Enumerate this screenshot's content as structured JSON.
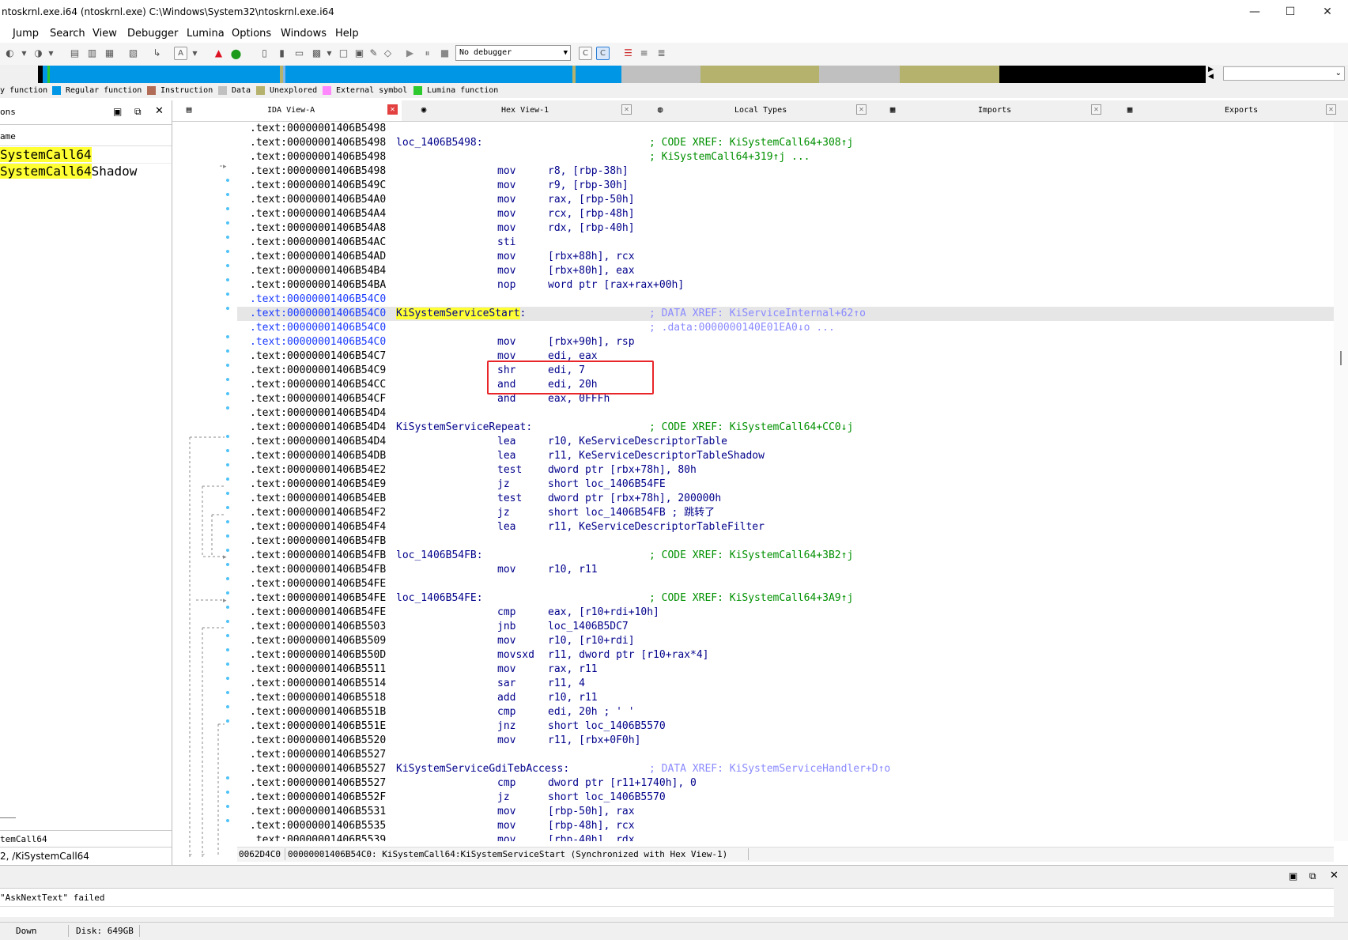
{
  "window": {
    "title": "ntoskrnl.exe.i64 (ntoskrnl.exe) C:\\Windows\\System32\\ntoskrnl.exe.i64",
    "minimize_glyph": "—",
    "maximize_glyph": "☐",
    "close_glyph": "✕"
  },
  "menu": [
    "Jump",
    "Search",
    "View",
    "Debugger",
    "Lumina",
    "Options",
    "Windows",
    "Help"
  ],
  "toolbar": {
    "debugger_select": "No debugger"
  },
  "legend": {
    "items": [
      {
        "label": "y function",
        "color": null
      },
      {
        "label": "Regular function",
        "color": "#0096e6"
      },
      {
        "label": "Instruction",
        "color": "#b06c56"
      },
      {
        "label": "Data",
        "color": "#c0c0c0"
      },
      {
        "label": "Unexplored",
        "color": "#b5b26d"
      },
      {
        "label": "External symbol",
        "color": "#ff88ff"
      },
      {
        "label": "Lumina function",
        "color": "#2ec92e"
      }
    ]
  },
  "left_panel": {
    "title": "ons",
    "column_header": "ame",
    "items": [
      {
        "highlight": "SystemCall64",
        "rest": ""
      },
      {
        "highlight": "SystemCall64",
        "rest": "Shadow"
      }
    ],
    "footer_line1": "temCall64",
    "footer_line2": "2, /KiSystemCall64"
  },
  "tabs": [
    {
      "label": "IDA View-A",
      "icon": "ida-view-icon",
      "active": true
    },
    {
      "label": "Hex View-1",
      "icon": "hex-view-icon",
      "active": false
    },
    {
      "label": "Local Types",
      "icon": "local-types-icon",
      "active": false
    },
    {
      "label": "Imports",
      "icon": "imports-icon",
      "active": false
    },
    {
      "label": "Exports",
      "icon": "exports-icon",
      "active": false
    }
  ],
  "code": {
    "lines": [
      {
        "addr": ".text:00000001406B5498",
        "label": "",
        "mnem": "",
        "ops": "",
        "cmt": ""
      },
      {
        "addr": ".text:00000001406B5498",
        "label": "loc_1406B5498:",
        "mnem": "",
        "ops": "",
        "cmt": "; CODE XREF: KiSystemCall64+308↑j"
      },
      {
        "addr": ".text:00000001406B5498",
        "label": "",
        "mnem": "",
        "ops": "",
        "cmt": "; KiSystemCall64+319↑j ..."
      },
      {
        "addr": ".text:00000001406B5498",
        "label": "",
        "mnem": "mov",
        "ops": "r8, [rbp-38h]",
        "cmt": ""
      },
      {
        "addr": ".text:00000001406B549C",
        "label": "",
        "mnem": "mov",
        "ops": "r9, [rbp-30h]",
        "cmt": ""
      },
      {
        "addr": ".text:00000001406B54A0",
        "label": "",
        "mnem": "mov",
        "ops": "rax, [rbp-50h]",
        "cmt": ""
      },
      {
        "addr": ".text:00000001406B54A4",
        "label": "",
        "mnem": "mov",
        "ops": "rcx, [rbp-48h]",
        "cmt": ""
      },
      {
        "addr": ".text:00000001406B54A8",
        "label": "",
        "mnem": "mov",
        "ops": "rdx, [rbp-40h]",
        "cmt": ""
      },
      {
        "addr": ".text:00000001406B54AC",
        "label": "",
        "mnem": "sti",
        "ops": "",
        "cmt": ""
      },
      {
        "addr": ".text:00000001406B54AD",
        "label": "",
        "mnem": "mov",
        "ops": "[rbx+88h], rcx",
        "cmt": ""
      },
      {
        "addr": ".text:00000001406B54B4",
        "label": "",
        "mnem": "mov",
        "ops": "[rbx+80h], eax",
        "cmt": ""
      },
      {
        "addr": ".text:00000001406B54BA",
        "label": "",
        "mnem": "nop",
        "ops": "word ptr [rax+rax+00h]",
        "cmt": ""
      },
      {
        "addr": ".text:00000001406B54C0",
        "label": "",
        "mnem": "",
        "ops": "",
        "cmt": "",
        "blue": true
      },
      {
        "addr": ".text:00000001406B54C0",
        "label": "KiSystemServiceStart",
        "mnem": "",
        "ops": "",
        "cmt": "; DATA XREF: KiServiceInternal+62↑o",
        "blue": true,
        "label_hl": true,
        "current": true,
        "cmt_data": true
      },
      {
        "addr": ".text:00000001406B54C0",
        "label": "",
        "mnem": "",
        "ops": "",
        "cmt": "; .data:0000000140E01EA0↓o ...",
        "blue": true,
        "cmt_data": true
      },
      {
        "addr": ".text:00000001406B54C0",
        "label": "",
        "mnem": "mov",
        "ops": "[rbx+90h], rsp",
        "cmt": "",
        "blue": true
      },
      {
        "addr": ".text:00000001406B54C7",
        "label": "",
        "mnem": "mov",
        "ops": "edi, eax",
        "cmt": ""
      },
      {
        "addr": ".text:00000001406B54C9",
        "label": "",
        "mnem": "shr",
        "ops": "edi, 7",
        "cmt": ""
      },
      {
        "addr": ".text:00000001406B54CC",
        "label": "",
        "mnem": "and",
        "ops": "edi, 20h",
        "cmt": ""
      },
      {
        "addr": ".text:00000001406B54CF",
        "label": "",
        "mnem": "and",
        "ops": "eax, 0FFFh",
        "cmt": ""
      },
      {
        "addr": ".text:00000001406B54D4",
        "label": "",
        "mnem": "",
        "ops": "",
        "cmt": ""
      },
      {
        "addr": ".text:00000001406B54D4",
        "label": "KiSystemServiceRepeat:",
        "mnem": "",
        "ops": "",
        "cmt": "; CODE XREF: KiSystemCall64+CC0↓j"
      },
      {
        "addr": ".text:00000001406B54D4",
        "label": "",
        "mnem": "lea",
        "ops": "r10, KeServiceDescriptorTable",
        "cmt": ""
      },
      {
        "addr": ".text:00000001406B54DB",
        "label": "",
        "mnem": "lea",
        "ops": "r11, KeServiceDescriptorTableShadow",
        "cmt": ""
      },
      {
        "addr": ".text:00000001406B54E2",
        "label": "",
        "mnem": "test",
        "ops": "dword ptr [rbx+78h], 80h",
        "cmt": ""
      },
      {
        "addr": ".text:00000001406B54E9",
        "label": "",
        "mnem": "jz",
        "ops": "short loc_1406B54FE",
        "cmt": ""
      },
      {
        "addr": ".text:00000001406B54EB",
        "label": "",
        "mnem": "test",
        "ops": "dword ptr [rbx+78h], 200000h",
        "cmt": ""
      },
      {
        "addr": ".text:00000001406B54F2",
        "label": "",
        "mnem": "jz",
        "ops": "short loc_1406B54FB ; 跳转了",
        "cmt": ""
      },
      {
        "addr": ".text:00000001406B54F4",
        "label": "",
        "mnem": "lea",
        "ops": "r11, KeServiceDescriptorTableFilter",
        "cmt": ""
      },
      {
        "addr": ".text:00000001406B54FB",
        "label": "",
        "mnem": "",
        "ops": "",
        "cmt": ""
      },
      {
        "addr": ".text:00000001406B54FB",
        "label": "loc_1406B54FB:",
        "mnem": "",
        "ops": "",
        "cmt": "; CODE XREF: KiSystemCall64+3B2↑j"
      },
      {
        "addr": ".text:00000001406B54FB",
        "label": "",
        "mnem": "mov",
        "ops": "r10, r11",
        "cmt": ""
      },
      {
        "addr": ".text:00000001406B54FE",
        "label": "",
        "mnem": "",
        "ops": "",
        "cmt": ""
      },
      {
        "addr": ".text:00000001406B54FE",
        "label": "loc_1406B54FE:",
        "mnem": "",
        "ops": "",
        "cmt": "; CODE XREF: KiSystemCall64+3A9↑j"
      },
      {
        "addr": ".text:00000001406B54FE",
        "label": "",
        "mnem": "cmp",
        "ops": "eax, [r10+rdi+10h]",
        "cmt": ""
      },
      {
        "addr": ".text:00000001406B5503",
        "label": "",
        "mnem": "jnb",
        "ops": "loc_1406B5DC7",
        "cmt": ""
      },
      {
        "addr": ".text:00000001406B5509",
        "label": "",
        "mnem": "mov",
        "ops": "r10, [r10+rdi]",
        "cmt": ""
      },
      {
        "addr": ".text:00000001406B550D",
        "label": "",
        "mnem": "movsxd",
        "ops": "r11, dword ptr [r10+rax*4]",
        "cmt": ""
      },
      {
        "addr": ".text:00000001406B5511",
        "label": "",
        "mnem": "mov",
        "ops": "rax, r11",
        "cmt": ""
      },
      {
        "addr": ".text:00000001406B5514",
        "label": "",
        "mnem": "sar",
        "ops": "r11, 4",
        "cmt": ""
      },
      {
        "addr": ".text:00000001406B5518",
        "label": "",
        "mnem": "add",
        "ops": "r10, r11",
        "cmt": ""
      },
      {
        "addr": ".text:00000001406B551B",
        "label": "",
        "mnem": "cmp",
        "ops": "edi, 20h ; ' '",
        "cmt": ""
      },
      {
        "addr": ".text:00000001406B551E",
        "label": "",
        "mnem": "jnz",
        "ops": "short loc_1406B5570",
        "cmt": ""
      },
      {
        "addr": ".text:00000001406B5520",
        "label": "",
        "mnem": "mov",
        "ops": "r11, [rbx+0F0h]",
        "cmt": ""
      },
      {
        "addr": ".text:00000001406B5527",
        "label": "",
        "mnem": "",
        "ops": "",
        "cmt": ""
      },
      {
        "addr": ".text:00000001406B5527",
        "label": "KiSystemServiceGdiTebAccess:",
        "mnem": "",
        "ops": "",
        "cmt": "; DATA XREF: KiSystemServiceHandler+D↑o",
        "cmt_data": true
      },
      {
        "addr": ".text:00000001406B5527",
        "label": "",
        "mnem": "cmp",
        "ops": "dword ptr [r11+1740h], 0",
        "cmt": ""
      },
      {
        "addr": ".text:00000001406B552F",
        "label": "",
        "mnem": "jz",
        "ops": "short loc_1406B5570",
        "cmt": ""
      },
      {
        "addr": ".text:00000001406B5531",
        "label": "",
        "mnem": "mov",
        "ops": "[rbp-50h], rax",
        "cmt": ""
      },
      {
        "addr": ".text:00000001406B5535",
        "label": "",
        "mnem": "mov",
        "ops": "[rbp-48h], rcx",
        "cmt": ""
      },
      {
        "addr": ".text:00000001406B5539",
        "label": "",
        "mnem": "mov",
        "ops": "[rbp-40h], rdx",
        "cmt": ""
      }
    ]
  },
  "status_line": {
    "offset": "0062D4C0",
    "location": "00000001406B54C0: KiSystemCall64:KiSystemServiceStart (Synchronized with Hex View-1)"
  },
  "output": {
    "text": "\"AskNextText\" failed"
  },
  "statusbar": {
    "state": "Down",
    "disk": "Disk: 649GB"
  }
}
